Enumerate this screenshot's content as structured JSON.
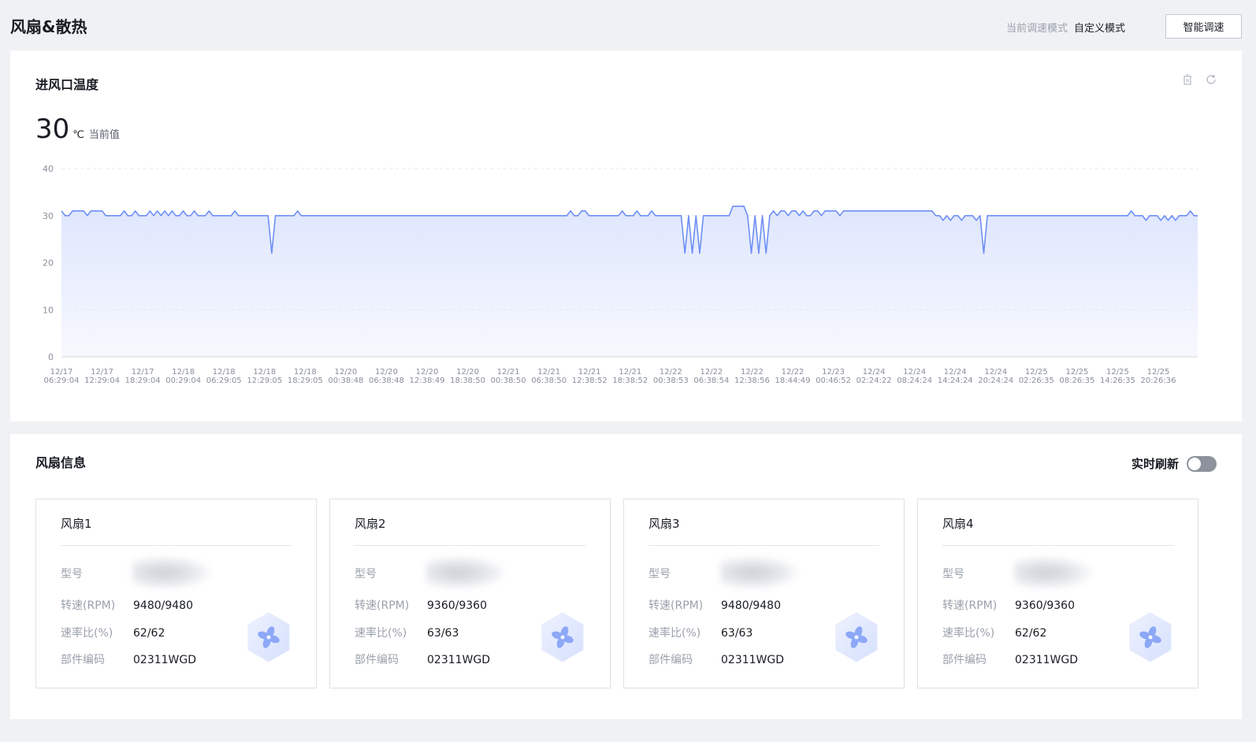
{
  "header": {
    "title": "风扇&散热",
    "mode_label": "当前调速模式",
    "mode_value": "自定义模式",
    "smart_button": "智能调速"
  },
  "chart_panel": {
    "title": "进风口温度",
    "current_value": "30",
    "unit": "℃",
    "current_label": "当前值",
    "icons": [
      "delete-icon",
      "refresh-icon"
    ]
  },
  "chart_data": {
    "type": "area",
    "title": "进风口温度",
    "xlabel": "",
    "ylabel": "",
    "ylim": [
      0,
      40
    ],
    "yticks": [
      "0",
      "10",
      "20",
      "30",
      "40"
    ],
    "x_ticks": [
      {
        "date": "12/17",
        "time": "06:29:04"
      },
      {
        "date": "12/17",
        "time": "12:29:04"
      },
      {
        "date": "12/17",
        "time": "18:29:04"
      },
      {
        "date": "12/18",
        "time": "00:29:04"
      },
      {
        "date": "12/18",
        "time": "06:29:05"
      },
      {
        "date": "12/18",
        "time": "12:29:05"
      },
      {
        "date": "12/18",
        "time": "18:29:05"
      },
      {
        "date": "12/20",
        "time": "00:38:48"
      },
      {
        "date": "12/20",
        "time": "06:38:48"
      },
      {
        "date": "12/20",
        "time": "12:38:49"
      },
      {
        "date": "12/20",
        "time": "18:38:50"
      },
      {
        "date": "12/21",
        "time": "00:38:50"
      },
      {
        "date": "12/21",
        "time": "06:38:50"
      },
      {
        "date": "12/21",
        "time": "12:38:52"
      },
      {
        "date": "12/21",
        "time": "18:38:52"
      },
      {
        "date": "12/22",
        "time": "00:38:53"
      },
      {
        "date": "12/22",
        "time": "06:38:54"
      },
      {
        "date": "12/22",
        "time": "12:38:56"
      },
      {
        "date": "12/22",
        "time": "18:44:49"
      },
      {
        "date": "12/23",
        "time": "00:46:52"
      },
      {
        "date": "12/24",
        "time": "02:24:22"
      },
      {
        "date": "12/24",
        "time": "08:24:24"
      },
      {
        "date": "12/24",
        "time": "14:24:24"
      },
      {
        "date": "12/24",
        "time": "20:24:24"
      },
      {
        "date": "12/25",
        "time": "02:26:35"
      },
      {
        "date": "12/25",
        "time": "08:26:35"
      },
      {
        "date": "12/25",
        "time": "14:26:35"
      },
      {
        "date": "12/25",
        "time": "20:26:36"
      }
    ],
    "series": [
      {
        "values": [
          31,
          30,
          30,
          31,
          31,
          31,
          31,
          30,
          31,
          31,
          31,
          31,
          30,
          30,
          30,
          30,
          30,
          31,
          30,
          30,
          31,
          30,
          30,
          30,
          31,
          30,
          31,
          30,
          31,
          30,
          31,
          30,
          30,
          31,
          30,
          30,
          31,
          30,
          30,
          30,
          31,
          30,
          30,
          30,
          30,
          30,
          30,
          31,
          30,
          30,
          30,
          30,
          30,
          30,
          30,
          30,
          30,
          22,
          30,
          30,
          30,
          30,
          30,
          30,
          31,
          30,
          30,
          30,
          30,
          30,
          30,
          30,
          30,
          30,
          30,
          30,
          30,
          30,
          30,
          30,
          30,
          30,
          30,
          30,
          30,
          30,
          30,
          30,
          30,
          30,
          30,
          30,
          30,
          30,
          30,
          30,
          30,
          30,
          30,
          30,
          30,
          30,
          30,
          30,
          30,
          30,
          30,
          30,
          30,
          30,
          30,
          30,
          30,
          30,
          30,
          30,
          30,
          30,
          30,
          30,
          30,
          30,
          30,
          30,
          30,
          30,
          30,
          30,
          30,
          30,
          30,
          30,
          30,
          30,
          30,
          30,
          30,
          30,
          31,
          30,
          30,
          31,
          31,
          30,
          30,
          30,
          30,
          30,
          30,
          30,
          30,
          30,
          31,
          30,
          30,
          30,
          31,
          30,
          30,
          30,
          31,
          30,
          30,
          30,
          30,
          30,
          30,
          30,
          30,
          22,
          30,
          22,
          30,
          22,
          30,
          30,
          30,
          30,
          30,
          30,
          30,
          30,
          32,
          32,
          32,
          32,
          30,
          22,
          30,
          22,
          30,
          22,
          30,
          31,
          30,
          31,
          31,
          30,
          31,
          31,
          30,
          31,
          30,
          30,
          31,
          31,
          30,
          31,
          31,
          31,
          31,
          30,
          31,
          31,
          31,
          31,
          31,
          31,
          31,
          31,
          31,
          31,
          31,
          31,
          31,
          31,
          31,
          31,
          31,
          31,
          31,
          31,
          31,
          31,
          31,
          31,
          31,
          30,
          30,
          29,
          30,
          29,
          30,
          30,
          29,
          30,
          30,
          30,
          29,
          30,
          22,
          30,
          30,
          30,
          30,
          30,
          30,
          30,
          30,
          30,
          30,
          30,
          30,
          30,
          30,
          30,
          30,
          30,
          30,
          30,
          30,
          30,
          30,
          30,
          30,
          30,
          30,
          30,
          30,
          30,
          30,
          30,
          30,
          30,
          30,
          30,
          30,
          30,
          30,
          30,
          31,
          30,
          30,
          30,
          29,
          30,
          30,
          30,
          29,
          30,
          29,
          30,
          29,
          30,
          30,
          30,
          31,
          30,
          30
        ]
      }
    ],
    "grid": true,
    "line_color": "#6e8ff5",
    "fill_color": "#dfe6fd"
  },
  "fan_panel": {
    "title": "风扇信息",
    "realtime_label": "实时刷新",
    "realtime_on": false,
    "keys": {
      "model": "型号",
      "speed": "转速(RPM)",
      "ratio": "速率比(%)",
      "part": "部件编码"
    },
    "fans": [
      {
        "name": "风扇1",
        "speed": "9480/9480",
        "ratio": "62/62",
        "part": "02311WGD"
      },
      {
        "name": "风扇2",
        "speed": "9360/9360",
        "ratio": "63/63",
        "part": "02311WGD"
      },
      {
        "name": "风扇3",
        "speed": "9480/9480",
        "ratio": "63/63",
        "part": "02311WGD"
      },
      {
        "name": "风扇4",
        "speed": "9360/9360",
        "ratio": "62/62",
        "part": "02311WGD"
      }
    ],
    "icon": "fan-icon"
  },
  "colors": {
    "accent": "#6e8ff5",
    "page_bg": "#f0f1f5",
    "toggle_off": "#8d929c"
  }
}
